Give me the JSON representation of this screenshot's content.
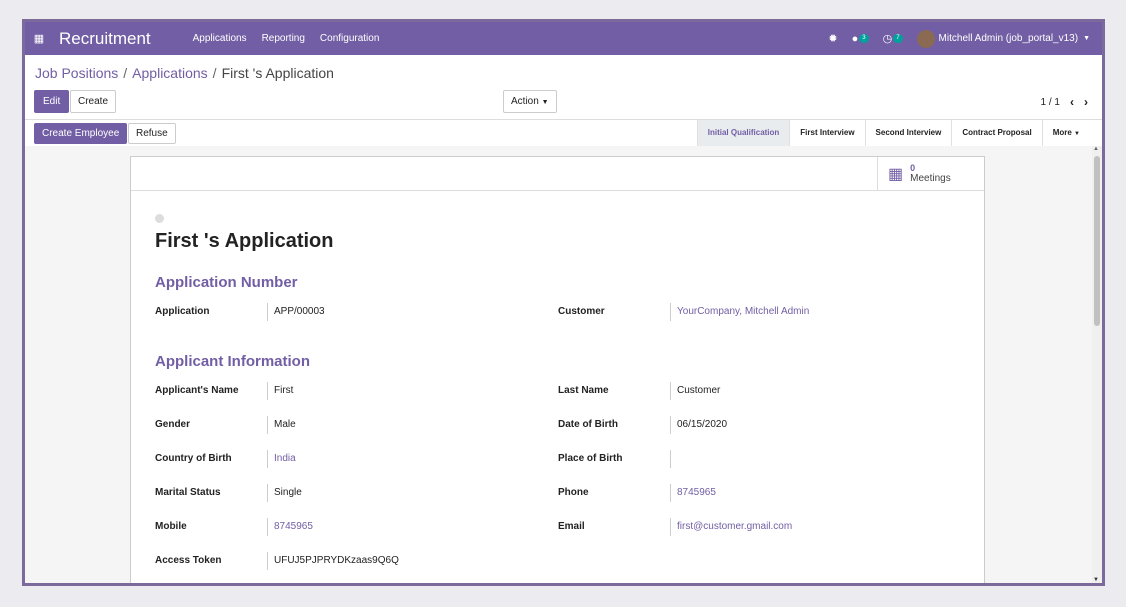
{
  "navbar": {
    "app_name": "Recruitment",
    "menu": [
      "Applications",
      "Reporting",
      "Configuration"
    ],
    "chat_badge": "3",
    "activity_badge": "7",
    "user": "Mitchell Admin (job_portal_v13)"
  },
  "breadcrumb": {
    "items": [
      "Job Positions",
      "Applications"
    ],
    "current": "First 's Application"
  },
  "buttons": {
    "edit": "Edit",
    "create": "Create",
    "action": "Action",
    "create_employee": "Create Employee",
    "refuse": "Refuse"
  },
  "pager": {
    "value": "1 / 1"
  },
  "stages": [
    "Initial Qualification",
    "First Interview",
    "Second Interview",
    "Contract Proposal"
  ],
  "stages_more": "More",
  "meetings": {
    "count": "0",
    "label": "Meetings"
  },
  "form": {
    "title": "First 's Application",
    "sections": {
      "application_number": "Application Number",
      "applicant_info": "Applicant Information"
    },
    "fields": {
      "application": {
        "label": "Application",
        "value": "APP/00003"
      },
      "customer": {
        "label": "Customer",
        "value": "YourCompany, Mitchell Admin"
      },
      "applicant_name": {
        "label": "Applicant's Name",
        "value": "First"
      },
      "last_name": {
        "label": "Last Name",
        "value": "Customer"
      },
      "gender": {
        "label": "Gender",
        "value": "Male"
      },
      "date_of_birth": {
        "label": "Date of Birth",
        "value": "06/15/2020"
      },
      "country_of_birth": {
        "label": "Country of Birth",
        "value": "India"
      },
      "place_of_birth": {
        "label": "Place of Birth",
        "value": ""
      },
      "marital_status": {
        "label": "Marital Status",
        "value": "Single"
      },
      "phone": {
        "label": "Phone",
        "value": "8745965"
      },
      "mobile": {
        "label": "Mobile",
        "value": "8745965"
      },
      "email": {
        "label": "Email",
        "value": "first@customer.gmail.com"
      },
      "access_token": {
        "label": "Access Token",
        "value": "UFUJ5PJPRYDKzaas9Q6Q"
      }
    }
  },
  "colors": {
    "brand": "#725ea4",
    "badge": "#00a09d"
  }
}
